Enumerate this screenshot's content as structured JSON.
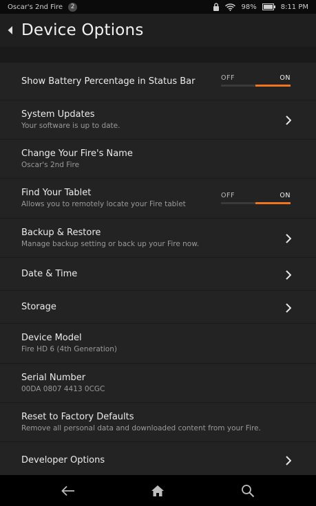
{
  "status_bar": {
    "device_name": "Oscar's 2nd Fire",
    "notification_count": "2",
    "battery_percent": "98%",
    "time": "8:11 PM",
    "icons": [
      "lock-icon",
      "wifi-icon",
      "battery-icon"
    ]
  },
  "header": {
    "title": "Device Options"
  },
  "settings": {
    "battery_percentage": {
      "title": "Show Battery Percentage in Status Bar",
      "toggle": {
        "off_label": "OFF",
        "on_label": "ON",
        "state": "on"
      }
    },
    "system_updates": {
      "title": "System Updates",
      "subtitle": "Your software is up to date."
    },
    "fire_name": {
      "title": "Change Your Fire's Name",
      "subtitle": "Oscar's 2nd Fire"
    },
    "find_tablet": {
      "title": "Find Your Tablet",
      "subtitle": "Allows you to remotely locate your Fire tablet",
      "toggle": {
        "off_label": "OFF",
        "on_label": "ON",
        "state": "on"
      }
    },
    "backup_restore": {
      "title": "Backup & Restore",
      "subtitle": "Manage backup setting or back up your Fire now."
    },
    "date_time": {
      "title": "Date & Time"
    },
    "storage": {
      "title": "Storage"
    },
    "device_model": {
      "title": "Device Model",
      "subtitle": "Fire HD 6 (4th Generation)"
    },
    "serial_number": {
      "title": "Serial Number",
      "subtitle": "00DA 0807 4413 0CGC"
    },
    "factory_reset": {
      "title": "Reset to Factory Defaults",
      "subtitle": "Remove all personal data and downloaded content from your Fire."
    },
    "developer_options": {
      "title": "Developer Options"
    }
  },
  "nav_bar": {
    "icons": [
      "back-arrow-icon",
      "home-icon",
      "search-icon"
    ]
  },
  "colors": {
    "accent": "#f0751e",
    "background": "#1a1a1a",
    "row_background": "#232323"
  }
}
